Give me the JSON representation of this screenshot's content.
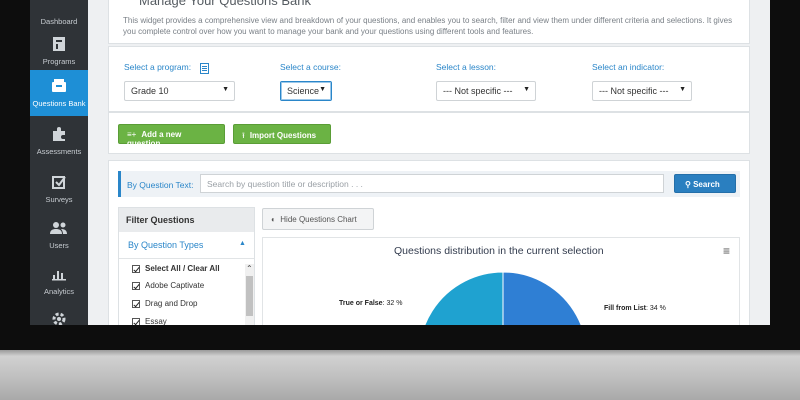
{
  "sidebar": {
    "items": [
      {
        "label": "Dashboard",
        "icon": "dashboard-icon"
      },
      {
        "label": "Programs",
        "icon": "programs-icon"
      },
      {
        "label": "Questions Bank",
        "icon": "questions-bank-icon",
        "active": true
      },
      {
        "label": "Assessments",
        "icon": "puzzle-icon"
      },
      {
        "label": "Surveys",
        "icon": "checkbox-icon"
      },
      {
        "label": "Users",
        "icon": "users-icon"
      },
      {
        "label": "Analytics",
        "icon": "bar-chart-icon"
      },
      {
        "label": "",
        "icon": "gear-icon"
      }
    ]
  },
  "header": {
    "title": "Manage Your Questions Bank",
    "intro": "This widget provides a comprehensive view and breakdown of your questions, and enables you to search, filter and view them under different criteria and selections. It gives you complete control over how you want to manage your bank and your questions using different tools and features."
  },
  "selectors": {
    "program": {
      "label": "Select a program:",
      "value": "Grade 10"
    },
    "course": {
      "label": "Select a course:",
      "value": "Science"
    },
    "lesson": {
      "label": "Select a lesson:",
      "value": "--- Not specific ---"
    },
    "indicator": {
      "label": "Select an indicator:",
      "value": "--- Not specific ---"
    }
  },
  "actions": {
    "add_question": "Add a new question",
    "import_questions": "Import Questions"
  },
  "search": {
    "label": "By Question Text:",
    "placeholder": "Search by question title or description . . .",
    "button": "Search"
  },
  "filter": {
    "title": "Filter Questions",
    "section": "By Question Types",
    "options": [
      "Select All / Clear All",
      "Adobe Captivate",
      "Drag and Drop",
      "Essay"
    ]
  },
  "chart_toggle": "Hide Questions Chart",
  "chart_data": {
    "type": "pie",
    "title": "Questions distribution in the current selection",
    "slices": [
      {
        "label": "True or False",
        "value": 32,
        "display": "32 %",
        "color": "#1fa2d0"
      },
      {
        "label": "Fill from List",
        "value": 34,
        "display": "34 %",
        "color": "#2f7fd4"
      }
    ]
  },
  "colors": {
    "sidebar_bg": "#2f3337",
    "active": "#1e8fd6",
    "green": "#6bb344",
    "blue": "#2a7fc0"
  }
}
